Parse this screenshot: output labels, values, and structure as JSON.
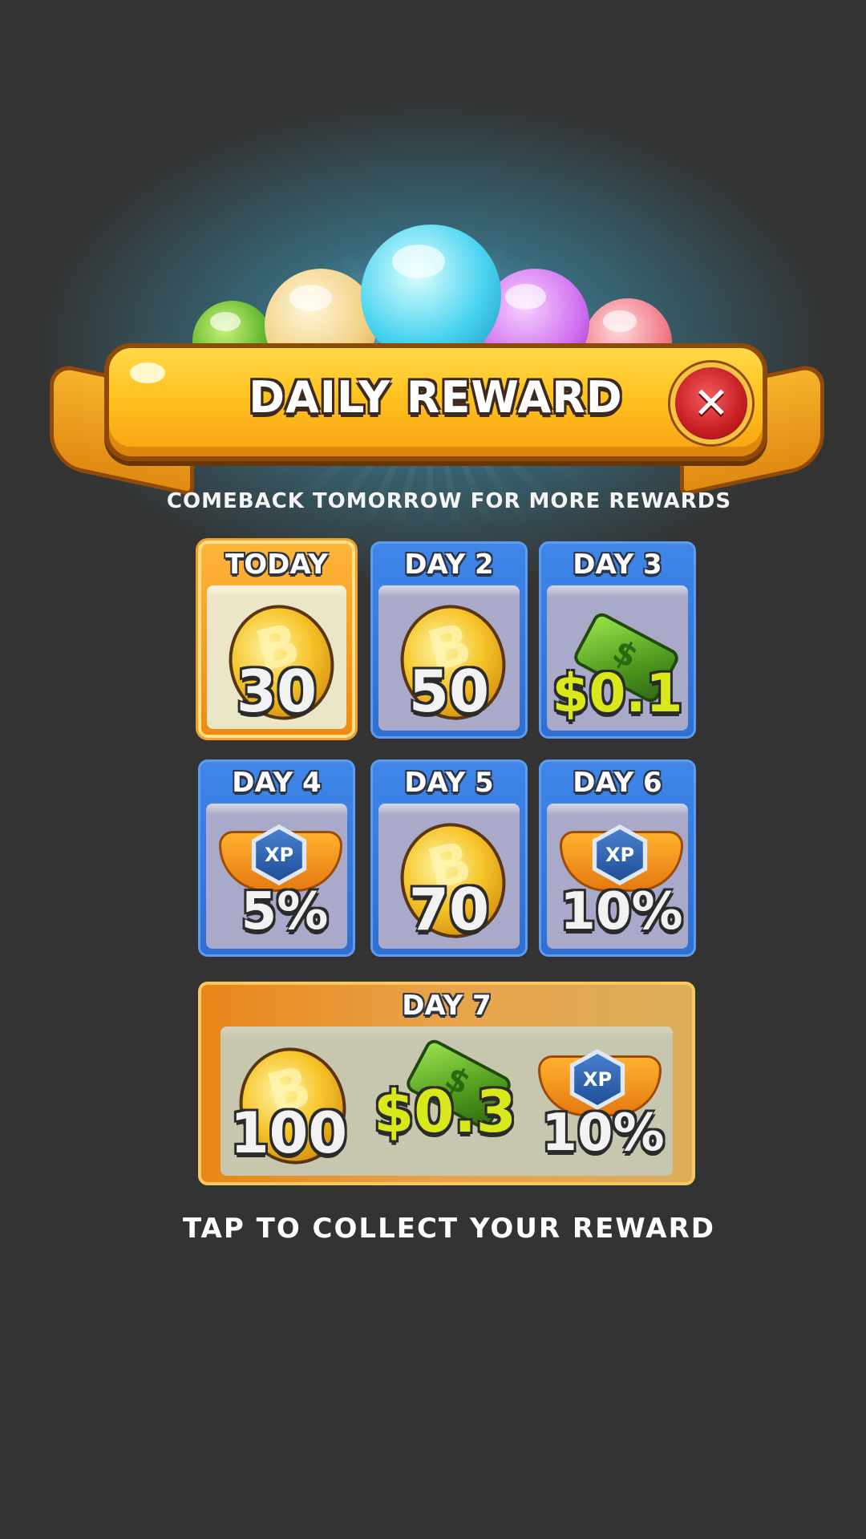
{
  "header": {
    "title": "DAILY REWARD",
    "close_icon": "close-icon"
  },
  "subtitle": "COMEBACK TOMORROW FOR MORE REWARDS",
  "rewards": [
    {
      "title": "TODAY",
      "icon": "coin-icon",
      "amount": "30"
    },
    {
      "title": "DAY 2",
      "icon": "coin-icon",
      "amount": "50"
    },
    {
      "title": "DAY 3",
      "icon": "cash-icon",
      "amount": "$0.1"
    },
    {
      "title": "DAY 4",
      "icon": "xp-badge-icon",
      "amount": "5%"
    },
    {
      "title": "DAY 5",
      "icon": "coin-icon",
      "amount": "70"
    },
    {
      "title": "DAY 6",
      "icon": "xp-badge-icon",
      "amount": "10%"
    }
  ],
  "day7": {
    "title": "DAY 7",
    "items": [
      {
        "icon": "coin-icon",
        "amount": "100"
      },
      {
        "icon": "cash-icon",
        "amount": "$0.3"
      },
      {
        "icon": "xp-badge-icon",
        "amount": "10%"
      }
    ]
  },
  "xp_label": "XP",
  "footer": {
    "collect_label": "TAP TO COLLECT YOUR REWARD"
  },
  "colors": {
    "background": "#333333",
    "banner": "#ffc21f",
    "card_blue": "#3f86e8",
    "card_today": "#f08a12",
    "cash_text": "#d8e81a"
  }
}
